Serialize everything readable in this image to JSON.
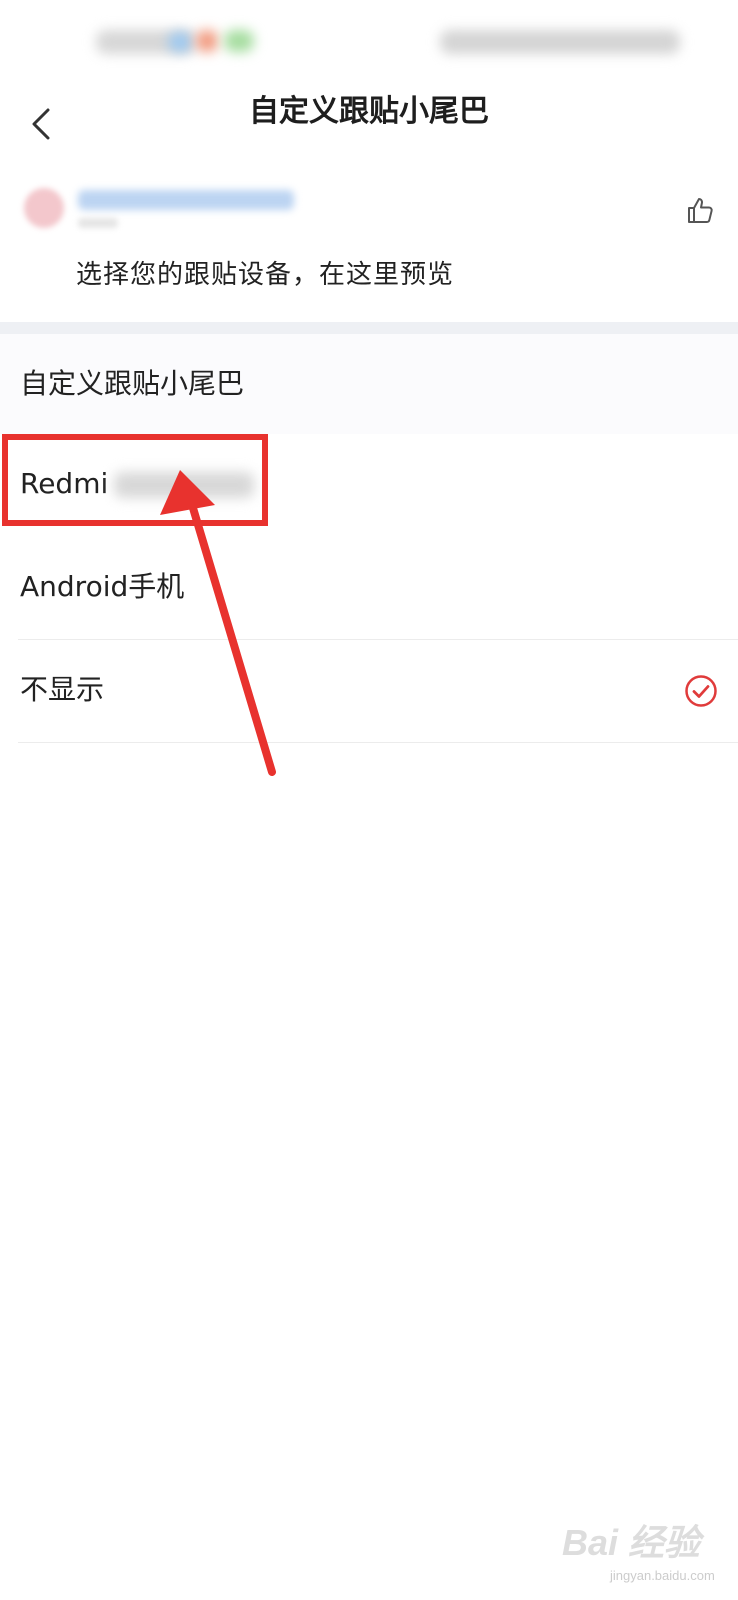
{
  "header": {
    "title": "自定义跟贴小尾巴"
  },
  "preview": {
    "text": "选择您的跟贴设备，在这里预览"
  },
  "options": [
    {
      "label": "自定义跟贴小尾巴",
      "selected": false
    },
    {
      "label": "Redmi",
      "selected": false
    },
    {
      "label": "Android手机",
      "selected": false
    },
    {
      "label": "不显示",
      "selected": true
    }
  ],
  "watermark": {
    "brand": "Bai 经验",
    "url": "jingyan.baidu.com"
  },
  "colors": {
    "accent": "#e8322e",
    "check": "#e03b3b"
  },
  "icons": {
    "back": "chevron-left-icon",
    "like": "thumbs-up-icon",
    "check": "check-circle-icon"
  }
}
